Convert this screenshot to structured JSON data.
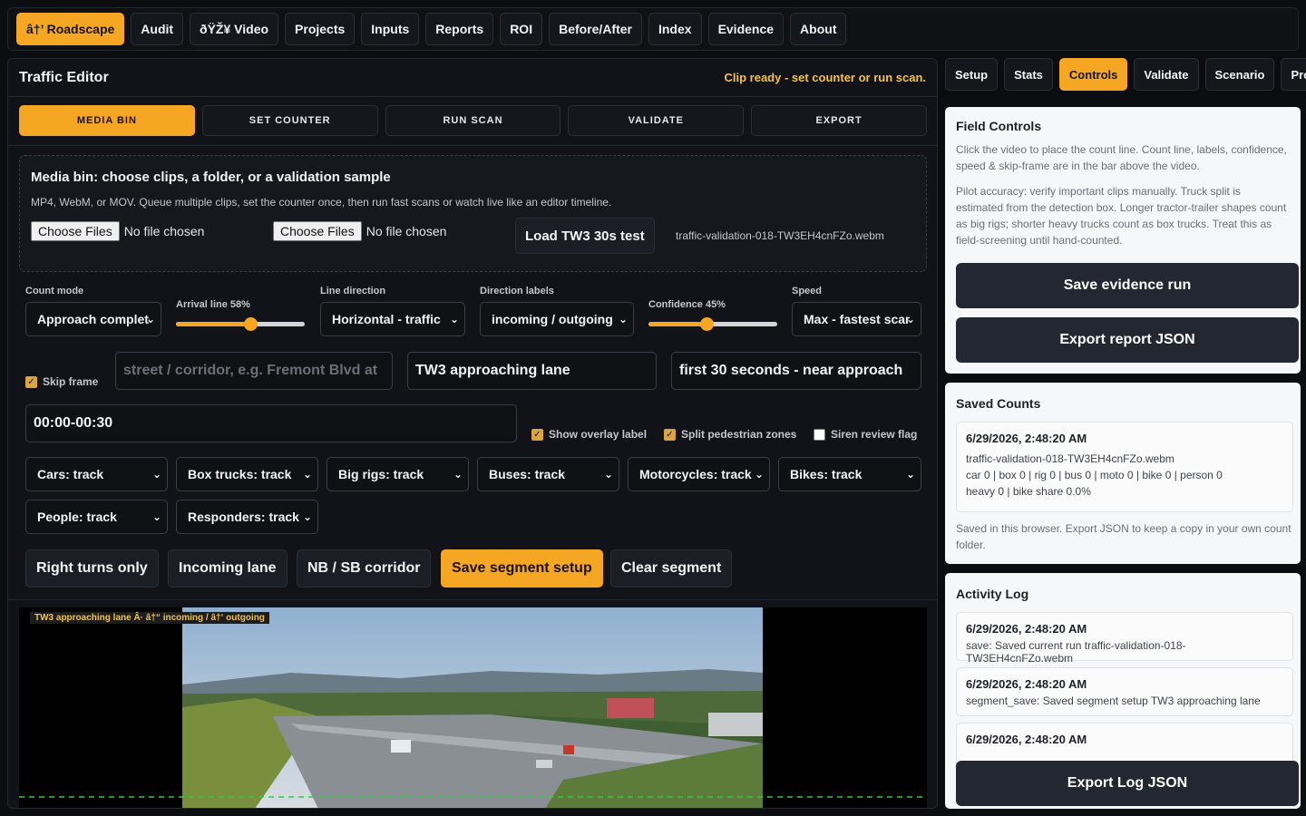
{
  "nav": {
    "items": [
      "â†’ Roadscape",
      "Audit",
      "ðŸŽ¥ Video",
      "Projects",
      "Inputs",
      "Reports",
      "ROI",
      "Before/After",
      "Index",
      "Evidence",
      "About"
    ]
  },
  "editor": {
    "title": "Traffic Editor",
    "status": "Clip ready - set counter or run scan.",
    "steps": [
      "MEDIA BIN",
      "SET COUNTER",
      "RUN SCAN",
      "VALIDATE",
      "EXPORT"
    ]
  },
  "mediabin": {
    "heading": "Media bin: choose clips, a folder, or a validation sample",
    "desc": "MP4, WebM, or MOV. Queue multiple clips, set the counter once, then run fast scans or watch live like an editor timeline.",
    "choose_label": "Choose Files",
    "no_file": "No file chosen",
    "load_button": "Load TW3 30s test",
    "loaded_file": "traffic-validation-018-TW3EH4cnFZo.webm"
  },
  "controls": {
    "count_mode_label": "Count mode",
    "count_mode_value": "Approach complete",
    "arrival_label": "Arrival line 58%",
    "arrival_value": 58,
    "line_direction_label": "Line direction",
    "line_direction_value": "Horizontal - traffic",
    "direction_labels_label": "Direction labels",
    "direction_labels_value": "incoming / outgoing",
    "confidence_label": "Confidence 45%",
    "confidence_value": 45,
    "speed_label": "Speed",
    "speed_value": "Max - fastest scan",
    "skip_frame_label": "Skip frame",
    "street_placeholder": "street / corridor, e.g. Fremont Blvd at",
    "lane_value": "TW3 approaching lane",
    "window_value": "first 30 seconds - near approach",
    "time_value": "00:00-00:30",
    "show_overlay_label": "Show overlay label",
    "split_ped_label": "Split pedestrian zones",
    "siren_label": "Siren review flag",
    "classes": [
      "Cars: track",
      "Box trucks: track",
      "Big rigs: track",
      "Buses: track",
      "Motorcycles: track",
      "Bikes: track",
      "People: track",
      "Responders: track"
    ]
  },
  "presets": {
    "right_turns": "Right turns only",
    "incoming_lane": "Incoming lane",
    "corridor": "NB / SB corridor",
    "save_segment": "Save segment setup",
    "clear_segment": "Clear segment"
  },
  "video": {
    "overlay": "TW3 approaching lane Â· â†“ incoming / â†‘ outgoing"
  },
  "right": {
    "tabs": [
      "Setup",
      "Stats",
      "Controls",
      "Validate",
      "Scenario",
      "Projects"
    ],
    "field_controls": {
      "title": "Field Controls",
      "p1": "Click the video to place the count line. Count line, labels, confidence, speed & skip-frame are in the bar above the video.",
      "p2": "Pilot accuracy: verify important clips manually. Truck split is estimated from the detection box. Longer tractor-trailer shapes count as big rigs; shorter heavy trucks count as box trucks. Treat this as field-screening until hand-counted.",
      "save_btn": "Save evidence run",
      "export_btn": "Export report JSON"
    },
    "saved_counts": {
      "title": "Saved Counts",
      "entry_time": "6/29/2026, 2:48:20 AM",
      "entry_file": "traffic-validation-018-TW3EH4cnFZo.webm",
      "entry_counts": "car 0 | box 0 | rig 0 | bus 0 | moto 0 | bike 0 | person 0",
      "entry_heavy": "heavy 0 | bike share 0.0%",
      "note": "Saved in this browser. Export JSON to keep a copy in your own count folder."
    },
    "activity": {
      "title": "Activity Log",
      "entries": [
        {
          "when": "6/29/2026, 2:48:20 AM",
          "text": "save: Saved current run traffic-validation-018-TW3EH4cnFZo.webm"
        },
        {
          "when": "6/29/2026, 2:48:20 AM",
          "text": "segment_save: Saved segment setup TW3 approaching lane"
        },
        {
          "when": "6/29/2026, 2:48:20 AM",
          "text": ""
        }
      ],
      "export_btn": "Export Log JSON"
    }
  }
}
